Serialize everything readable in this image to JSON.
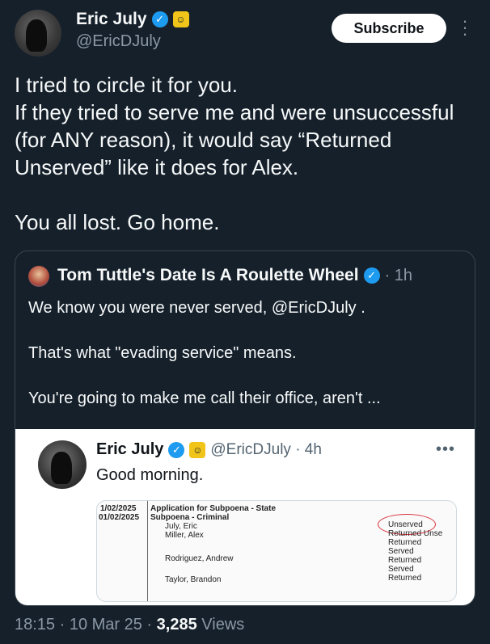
{
  "author": {
    "display_name": "Eric July",
    "handle": "@EricDJuly",
    "verified_icon": "verified-check-icon",
    "affiliate_icon": "affiliate-badge-icon"
  },
  "header": {
    "subscribe_label": "Subscribe",
    "more_icon": "more-vertical-icon"
  },
  "tweet": {
    "lines": [
      "I tried to circle it for you.",
      "If they tried to serve me and were unsuccessful (for ANY reason), it would say “Returned Unserved” like it does for Alex.",
      "You all lost. Go home."
    ]
  },
  "quote": {
    "display_name": "Tom Tuttle's Date Is A Roulette Wheel",
    "time": "· 1h",
    "lines": [
      "We know you were never served, @EricDJuly .",
      "That's what \"evading service\" means.",
      "You're going to make me call their office, aren't ..."
    ],
    "embedded": {
      "display_name": "Eric July",
      "handle_time": "@EricDJuly · 4h",
      "text": "Good morning.",
      "more_icon": "more-horizontal-icon",
      "document": {
        "rows": [
          {
            "date": "1/02/2025",
            "desc": "Application for Subpoena - State"
          },
          {
            "date": "01/02/2025",
            "desc": "Subpoena - Criminal"
          }
        ],
        "names": [
          "July, Eric",
          "Miller, Alex",
          "Rodriguez, Andrew",
          "Taylor, Brandon"
        ],
        "statuses": [
          "Unserved",
          "Returned Unse",
          "Returned",
          "Served",
          "Returned",
          "Served",
          "Returned"
        ]
      }
    }
  },
  "footer": {
    "time_date": "18:15 · 10 Mar 25 · ",
    "views_count": "3,285",
    "views_label": " Views"
  }
}
